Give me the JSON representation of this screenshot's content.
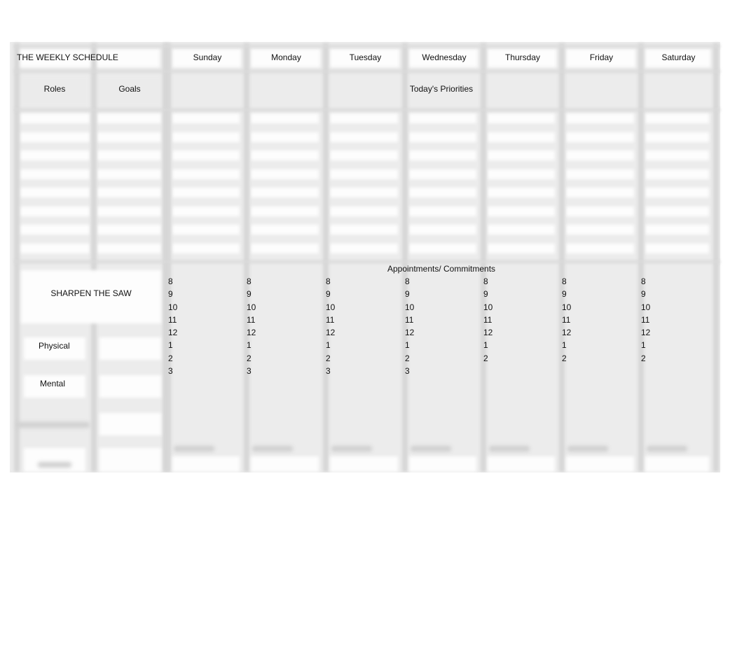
{
  "title": "THE WEEKLY SCHEDULE",
  "days": [
    "Sunday",
    "Monday",
    "Tuesday",
    "Wednesday",
    "Thursday",
    "Friday",
    "Saturday"
  ],
  "headers": {
    "roles": "Roles",
    "goals": "Goals",
    "priorities": "Today's Priorities",
    "appointments": "Appointments/ Commitments"
  },
  "sharpen_the_saw": {
    "title": "SHARPEN THE SAW",
    "items": [
      "Physical",
      "Mental"
    ]
  },
  "hour_columns": [
    {
      "day": "Sunday",
      "hours": "8\n9\n10\n11\n12\n1\n2\n3"
    },
    {
      "day": "Monday",
      "hours": "8\n9\n10\n11\n12\n1\n2\n3"
    },
    {
      "day": "Tuesday",
      "hours": "8\n9\n10\n11\n12\n1\n2\n3"
    },
    {
      "day": "Wednesday",
      "hours": "8\n9\n10\n11\n12\n1\n2\n3"
    },
    {
      "day": "Thursday",
      "hours": "8\n9\n10\n11\n12\n1\n2"
    },
    {
      "day": "Friday",
      "hours": "8\n9\n10\n11\n12\n1\n2"
    },
    {
      "day": "Saturday",
      "hours": "8\n9\n10\n11\n12\n1\n2"
    }
  ]
}
